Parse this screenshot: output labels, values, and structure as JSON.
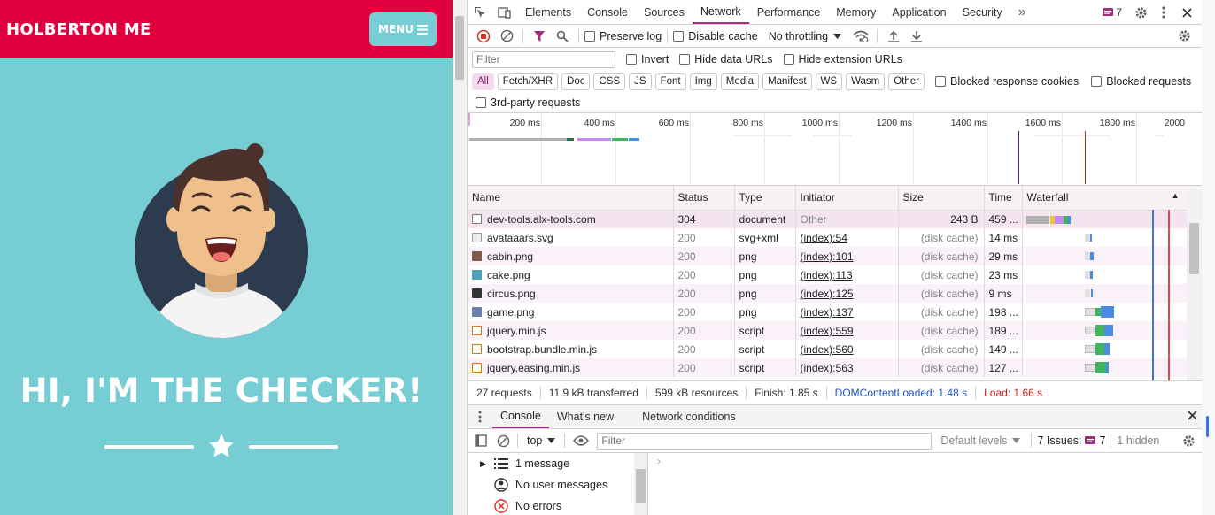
{
  "site": {
    "brand": "HOLBERTON ME",
    "menu_label": "MENU",
    "headline": "HI, I'M THE CHECKER!"
  },
  "devtools": {
    "tabs": [
      "Elements",
      "Console",
      "Sources",
      "Network",
      "Performance",
      "Memory",
      "Application",
      "Security"
    ],
    "active_tab": "Network",
    "more": "»",
    "issues_count": "7",
    "toolbar": {
      "preserve_log": "Preserve log",
      "disable_cache": "Disable cache",
      "throttling": "No throttling"
    },
    "filter": {
      "placeholder": "Filter",
      "invert": "Invert",
      "hide_data_urls": "Hide data URLs",
      "hide_extension_urls": "Hide extension URLs"
    },
    "types": [
      "All",
      "Fetch/XHR",
      "Doc",
      "CSS",
      "JS",
      "Font",
      "Img",
      "Media",
      "Manifest",
      "WS",
      "Wasm",
      "Other"
    ],
    "blocked_response_cookies": "Blocked response cookies",
    "blocked_requests": "Blocked requests",
    "third_party": "3rd-party requests",
    "overview_ticks": [
      "200 ms",
      "400 ms",
      "600 ms",
      "800 ms",
      "1000 ms",
      "1200 ms",
      "1400 ms",
      "1600 ms",
      "1800 ms",
      "2000"
    ],
    "columns": [
      "Name",
      "Status",
      "Type",
      "Initiator",
      "Size",
      "Time",
      "Waterfall"
    ],
    "requests": [
      {
        "name": "dev-tools.alx-tools.com",
        "status": "304",
        "type": "document",
        "initiator": "Other",
        "size": "243 B",
        "time": "459 ...",
        "icon": "document-icon"
      },
      {
        "name": "avataaars.svg",
        "status": "200",
        "type": "svg+xml",
        "initiator": "(index):54",
        "size": "(disk cache)",
        "time": "14 ms",
        "icon": "image-icon"
      },
      {
        "name": "cabin.png",
        "status": "200",
        "type": "png",
        "initiator": "(index):101",
        "size": "(disk cache)",
        "time": "29 ms",
        "icon": "image-icon"
      },
      {
        "name": "cake.png",
        "status": "200",
        "type": "png",
        "initiator": "(index):113",
        "size": "(disk cache)",
        "time": "23 ms",
        "icon": "image-icon"
      },
      {
        "name": "circus.png",
        "status": "200",
        "type": "png",
        "initiator": "(index):125",
        "size": "(disk cache)",
        "time": "9 ms",
        "icon": "image-icon"
      },
      {
        "name": "game.png",
        "status": "200",
        "type": "png",
        "initiator": "(index):137",
        "size": "(disk cache)",
        "time": "198 ...",
        "icon": "image-icon"
      },
      {
        "name": "jquery.min.js",
        "status": "200",
        "type": "script",
        "initiator": "(index):559",
        "size": "(disk cache)",
        "time": "189 ...",
        "icon": "script-icon"
      },
      {
        "name": "bootstrap.bundle.min.js",
        "status": "200",
        "type": "script",
        "initiator": "(index):560",
        "size": "(disk cache)",
        "time": "149 ...",
        "icon": "script-icon"
      },
      {
        "name": "jquery.easing.min.js",
        "status": "200",
        "type": "script",
        "initiator": "(index):563",
        "size": "(disk cache)",
        "time": "127 ...",
        "icon": "script-icon"
      }
    ],
    "summary": {
      "requests": "27 requests",
      "transferred": "11.9 kB transferred",
      "resources": "599 kB resources",
      "finish": "Finish: 1.85 s",
      "dom_loaded": "DOMContentLoaded: 1.48 s",
      "load": "Load: 1.66 s"
    },
    "drawer": {
      "tabs": [
        "Console",
        "What's new",
        "Network conditions"
      ],
      "context": "top",
      "filter_placeholder": "Filter",
      "levels": "Default levels",
      "issues_label": "7 Issues:",
      "issues_count": "7",
      "hidden": "1 hidden",
      "sidebar": [
        "1 message",
        "No user messages",
        "No errors"
      ],
      "prompt": "›"
    },
    "colors": {
      "accent": "#a12f7e",
      "dom_blue": "#1a56c8",
      "load_red": "#c5221f"
    }
  }
}
